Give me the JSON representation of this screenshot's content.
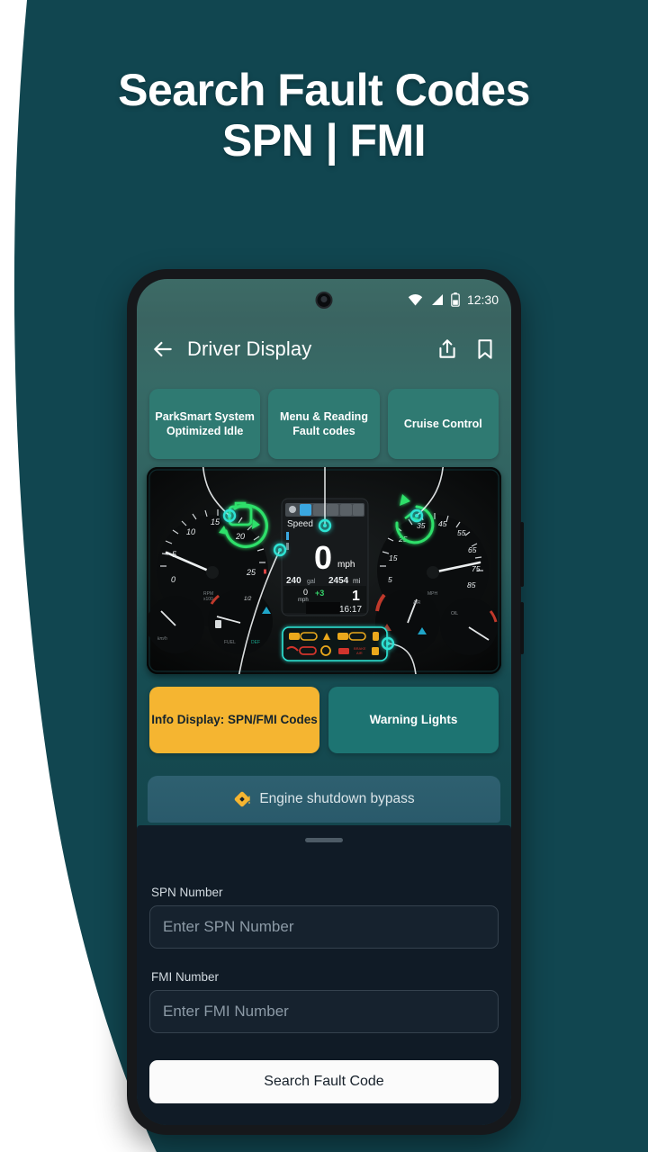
{
  "promo": {
    "headline_line1": "Search Fault Codes",
    "headline_line2": "SPN | FMI",
    "background_color": "#114650",
    "accent_color": "#2f7a72",
    "warning_color": "#f5b531"
  },
  "status_bar": {
    "time": "12:30",
    "wifi_icon": "wifi-icon",
    "signal_icon": "cellular-signal-icon",
    "battery_icon": "battery-icon"
  },
  "app_bar": {
    "back_icon": "back-arrow-icon",
    "title": "Driver Display",
    "share_icon": "share-icon",
    "bookmark_icon": "bookmark-icon"
  },
  "chips": [
    {
      "label": "ParkSmart System Optimized Idle"
    },
    {
      "label": "Menu & Reading Fault codes"
    },
    {
      "label": "Cruise Control"
    }
  ],
  "dashboard": {
    "center_display": {
      "header_label": "Speed",
      "speed_value": "0",
      "speed_unit": "mph",
      "fuel": "240 gal",
      "odometer": "2454 mi",
      "small_speed": "0",
      "small_speed_unit": "mph",
      "cruise_delta": "+3",
      "gear": "1",
      "clock": "16:17"
    },
    "tachometer": {
      "ticks": [
        "0",
        "5",
        "10",
        "15",
        "20",
        "25"
      ],
      "unit_label": "RPM x100"
    },
    "speedometer": {
      "ticks": [
        "5",
        "15",
        "25",
        "35",
        "45",
        "55",
        "65",
        "75",
        "85"
      ],
      "unit_label": "MPH"
    },
    "small_gauges": [
      "0 km/h",
      "FUEL",
      "DEF",
      "1/2",
      "AIR",
      "OIL"
    ],
    "warning_panel": {
      "row1_icons": [
        "engine-amber-icon",
        "cloud-amber-icon",
        "dpf-amber-icon",
        "engine2-amber-icon",
        "cloud2-amber-icon",
        "fluid-amber-icon"
      ],
      "row2_icons": [
        "seatbelt-red-icon",
        "coolant-red-icon",
        "brake-red-icon",
        "battery-red-icon",
        "brake-text-icon",
        "fuel-red-icon"
      ]
    },
    "callouts": [
      "parksmart-marker",
      "menu-marker",
      "cruise-marker",
      "info-display-marker",
      "warning-lights-marker"
    ]
  },
  "action_buttons": [
    {
      "label": "Info Display: SPN/FMI Codes",
      "color": "#f5b531"
    },
    {
      "label": "Warning Lights",
      "color": "#1d7472"
    }
  ],
  "bypass_bar": {
    "icon": "warning-diamond-icon",
    "label": "Engine shutdown bypass"
  },
  "sheet": {
    "grabber": "drag-handle",
    "spn": {
      "label": "SPN Number",
      "placeholder": "Enter SPN Number",
      "value": ""
    },
    "fmi": {
      "label": "FMI Number",
      "placeholder": "Enter FMI Number",
      "value": ""
    },
    "submit_label": "Search Fault Code"
  }
}
